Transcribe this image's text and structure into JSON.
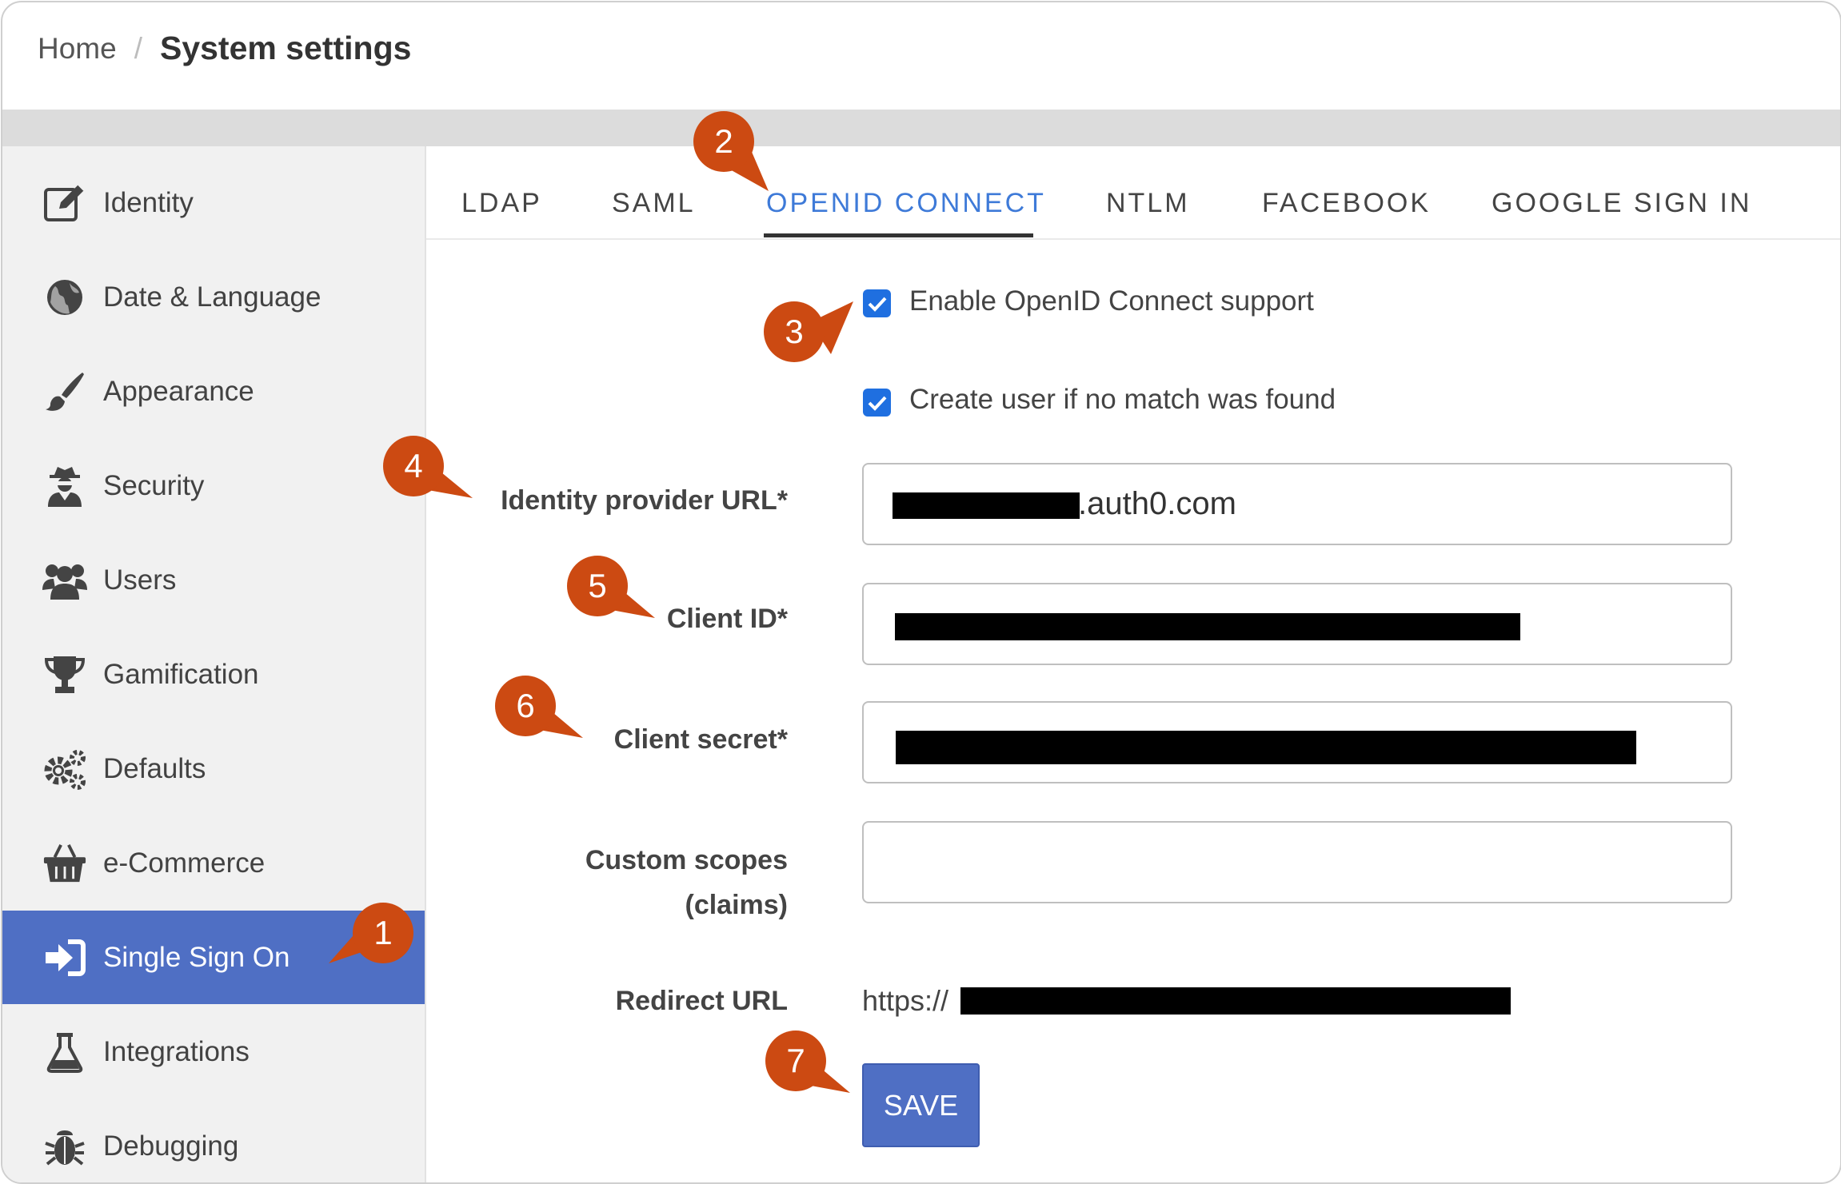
{
  "breadcrumb": {
    "home": "Home",
    "separator": "/",
    "current": "System settings"
  },
  "sidebar": {
    "items": [
      {
        "label": "Identity",
        "icon": "edit-icon",
        "active": false
      },
      {
        "label": "Date & Language",
        "icon": "globe-icon",
        "active": false
      },
      {
        "label": "Appearance",
        "icon": "paintbrush-icon",
        "active": false
      },
      {
        "label": "Security",
        "icon": "user-secret-icon",
        "active": false
      },
      {
        "label": "Users",
        "icon": "users-icon",
        "active": false
      },
      {
        "label": "Gamification",
        "icon": "trophy-icon",
        "active": false
      },
      {
        "label": "Defaults",
        "icon": "gears-icon",
        "active": false
      },
      {
        "label": "e-Commerce",
        "icon": "basket-icon",
        "active": false
      },
      {
        "label": "Single Sign On",
        "icon": "sign-in-icon",
        "active": true
      },
      {
        "label": "Integrations",
        "icon": "flask-icon",
        "active": false
      },
      {
        "label": "Debugging",
        "icon": "bug-icon",
        "active": false
      }
    ]
  },
  "tabs": [
    {
      "label": "LDAP",
      "active": false
    },
    {
      "label": "SAML",
      "active": false
    },
    {
      "label": "OPENID CONNECT",
      "active": true
    },
    {
      "label": "NTLM",
      "active": false
    },
    {
      "label": "FACEBOOK",
      "active": false
    },
    {
      "label": "GOOGLE SIGN IN",
      "active": false
    }
  ],
  "form": {
    "enable_openid": {
      "label": "Enable OpenID Connect support",
      "checked": true
    },
    "create_user": {
      "label": "Create user if no match was found",
      "checked": true
    },
    "idp_url": {
      "label": "Identity provider URL*",
      "value_visible": ".auth0.com"
    },
    "client_id": {
      "label": "Client ID*"
    },
    "client_secret": {
      "label": "Client secret*"
    },
    "custom_scopes": {
      "label_line1": "Custom scopes",
      "label_line2": "(claims)",
      "value": ""
    },
    "redirect_url": {
      "label": "Redirect URL",
      "value_visible": "https://"
    },
    "save_label": "SAVE"
  },
  "callouts": [
    "1",
    "2",
    "3",
    "4",
    "5",
    "6",
    "7"
  ],
  "colors": {
    "accent": "#4f6fc4",
    "active_tab": "#3e7ad8",
    "callout": "#cc4a12",
    "checkbox": "#1f6fe0",
    "sidebar_bg": "#f1f1f1",
    "band": "#dcdcdc"
  }
}
